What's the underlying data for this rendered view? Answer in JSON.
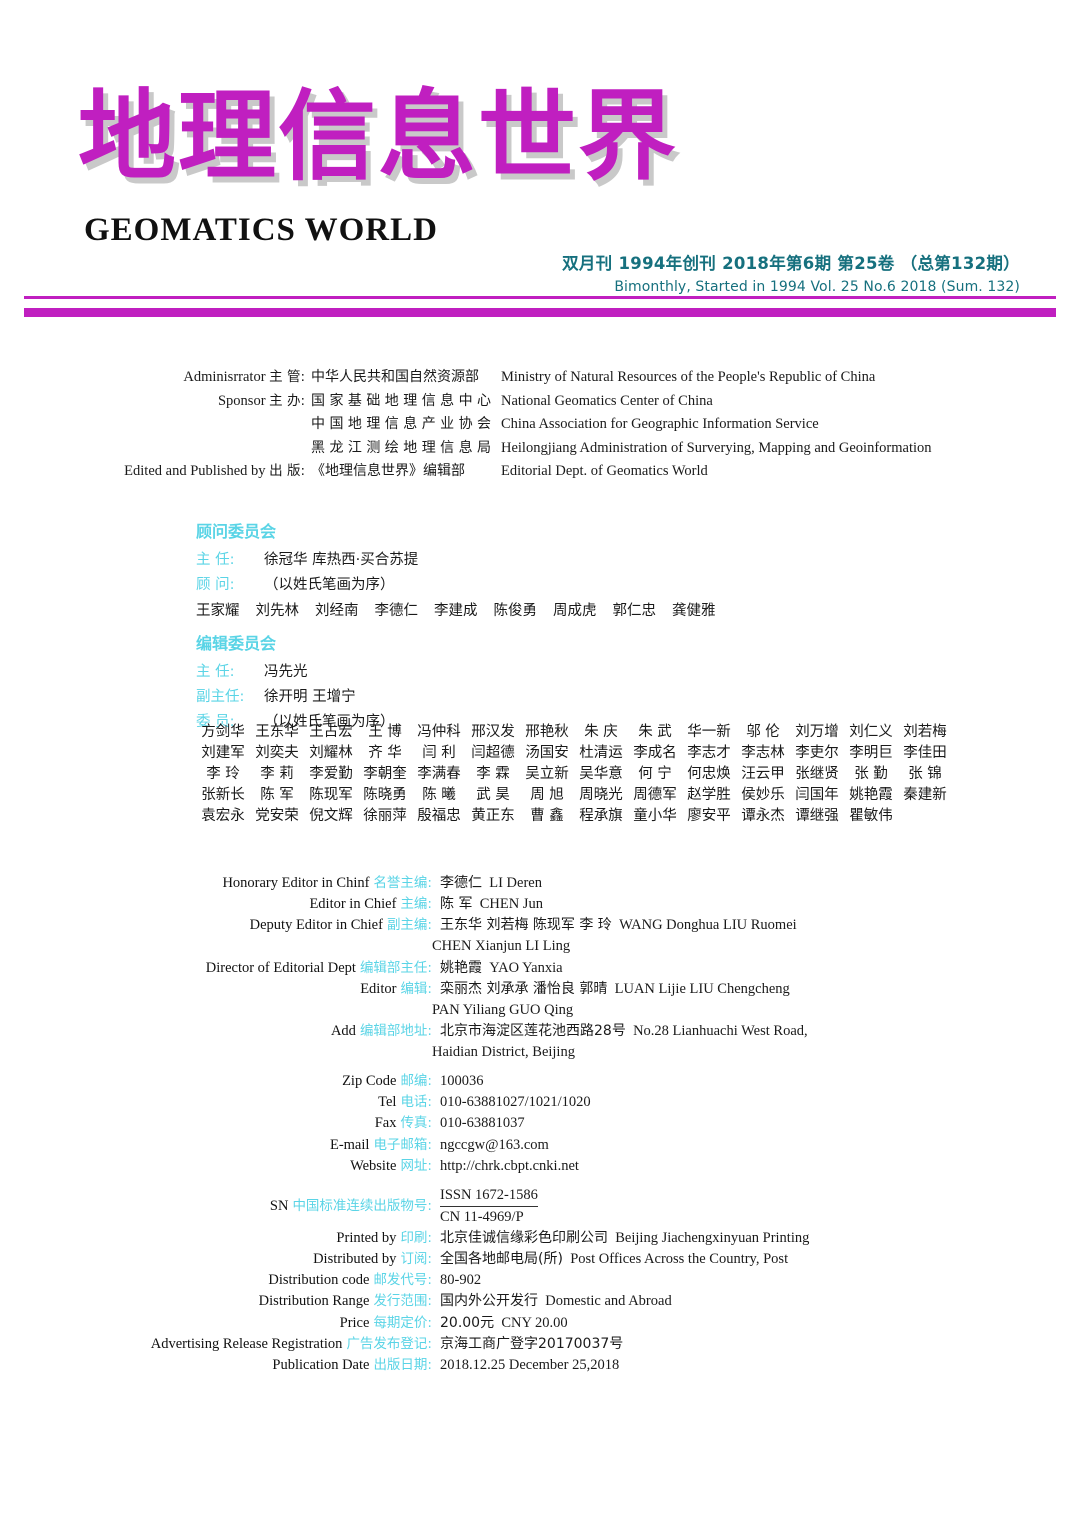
{
  "masthead": {
    "title_cn": "地理信息世界",
    "title_en": "GEOMATICS  WORLD",
    "issue_cn": "双月刊  1994年创刊  2018年第6期  第25卷 （总第132期）",
    "issue_en": "Bimonthly, Started in 1994 Vol. 25 No.6 2018 (Sum. 132)",
    "accent_color": "#c01fc0",
    "issue_color": "#16707e",
    "label_color": "#5ad4e6"
  },
  "publisher": [
    {
      "label_en": "Adminisrrator",
      "label_cn": "主  管:",
      "value_cn": "中华人民共和国自然资源部",
      "value_en": "Ministry of Natural Resources of the People's Republic of China"
    },
    {
      "label_en": "Sponsor",
      "label_cn": "主  办:",
      "value_cn": "国 家 基 础 地 理 信 息 中 心",
      "value_en": "National Geomatics Center of China"
    },
    {
      "label_en": "",
      "label_cn": "",
      "value_cn": "中 国 地 理 信 息 产 业 协 会",
      "value_en": "China Association for Geographic Information Service"
    },
    {
      "label_en": "",
      "label_cn": "",
      "value_cn": "黑 龙 江 测 绘 地 理 信 息 局",
      "value_en": "Heilongjiang Administration of Surverying, Mapping and Geoinformation"
    },
    {
      "label_en": "Edited and Published by",
      "label_cn": "出  版:",
      "value_cn": "《地理信息世界》编辑部",
      "value_en": "Editorial Dept. of Geomatics World"
    }
  ],
  "advisory": {
    "heading": "顾问委员会",
    "chair_label": "主  任:",
    "chair_value": "徐冠华    库热西·买合苏提",
    "advisor_label": "顾  问:",
    "advisor_note": "（以姓氏笔画为序）",
    "advisors": [
      "王家耀",
      "刘先林",
      "刘经南",
      "李德仁",
      "李建成",
      "陈俊勇",
      "周成虎",
      "郭仁忠",
      "龚健雅"
    ]
  },
  "editorial": {
    "heading": "编辑委员会",
    "chair_label": "主  任:",
    "chair_value": "冯先光",
    "vicechair_label": "副主任:",
    "vicechair_value": "徐开明    王增宁",
    "member_label": "委  员:",
    "member_note": "（以姓氏笔画为序）",
    "members": [
      [
        "方剑华",
        "王东华",
        "王占宏",
        "王 博",
        "冯仲科",
        "邢汉发",
        "邢艳秋",
        "朱 庆",
        "朱 武",
        "华一新",
        "邬 伦",
        "刘万增",
        "刘仁义",
        "刘若梅"
      ],
      [
        "刘建军",
        "刘奕夫",
        "刘耀林",
        "齐 华",
        "闫 利",
        "闫超德",
        "汤国安",
        "杜清运",
        "李成名",
        "李志才",
        "李志林",
        "李吏尔",
        "李明巨",
        "李佳田"
      ],
      [
        "李 玲",
        "李 莉",
        "李爱勤",
        "李朝奎",
        "李满春",
        "李 霖",
        "吴立新",
        "吴华意",
        "何 宁",
        "何忠焕",
        "汪云甲",
        "张继贤",
        "张 勤",
        "张 锦"
      ],
      [
        "张新长",
        "陈 军",
        "陈现军",
        "陈晓勇",
        "陈 曦",
        "武 昊",
        "周 旭",
        "周晓光",
        "周德军",
        "赵学胜",
        "侯妙乐",
        "闫国年",
        "姚艳霞",
        "秦建新"
      ],
      [
        "袁宏永",
        "党安荣",
        "倪文辉",
        "徐丽萍",
        "殷福忠",
        "黄正东",
        "曹 鑫",
        "程承旗",
        "童小华",
        "廖安平",
        "谭永杰",
        "谭继强",
        "瞿敏伟"
      ]
    ]
  },
  "details": [
    {
      "label_en": "Honorary Editor in Chinf",
      "label_cn": "名誉主编:",
      "value_cn": "李德仁",
      "value_en": "LI Deren",
      "cont": ""
    },
    {
      "label_en": "Editor in Chief",
      "label_cn": "主编:",
      "value_cn": "陈  军",
      "value_en": "CHEN Jun",
      "cont": ""
    },
    {
      "label_en": "Deputy Editor in Chief",
      "label_cn": "副主编:",
      "value_cn": "王东华  刘若梅  陈现军  李  玲",
      "value_en": "WANG Donghua  LIU Ruomei",
      "cont": "CHEN Xianjun  LI Ling"
    },
    {
      "label_en": "Director of Editorial Dept",
      "label_cn": "编辑部主任:",
      "value_cn": "姚艳霞",
      "value_en": "YAO Yanxia",
      "cont": ""
    },
    {
      "label_en": "Editor",
      "label_cn": "编辑:",
      "value_cn": "栾丽杰  刘承承  潘怡良  郭晴",
      "value_en": "LUAN Lijie  LIU Chengcheng",
      "cont": "PAN Yiliang  GUO Qing"
    },
    {
      "label_en": "Add",
      "label_cn": "编辑部地址:",
      "value_cn": "北京市海淀区莲花池西路28号",
      "value_en": "No.28 Lianhuachi West Road,",
      "cont": "Haidian District, Beijing"
    },
    {
      "label_en": "Zip Code",
      "label_cn": "邮编:",
      "value_cn": "",
      "value_en": "100036",
      "cont": ""
    },
    {
      "label_en": "Tel",
      "label_cn": "电话:",
      "value_cn": "",
      "value_en": "010-63881027/1021/1020",
      "cont": ""
    },
    {
      "label_en": "Fax",
      "label_cn": "传真:",
      "value_cn": "",
      "value_en": "010-63881037",
      "cont": ""
    },
    {
      "label_en": "E-mail",
      "label_cn": "电子邮箱:",
      "value_cn": "",
      "value_en": "ngccgw@163.com",
      "cont": ""
    },
    {
      "label_en": "Website",
      "label_cn": "网址:",
      "value_cn": "",
      "value_en": "http://chrk.cbpt.cnki.net",
      "cont": ""
    },
    {
      "label_en": "Printed by",
      "label_cn": "印刷:",
      "value_cn": "北京佳诚信缘彩色印刷公司",
      "value_en": "Beijing Jiachengxinyuan Printing",
      "cont": ""
    },
    {
      "label_en": "Distributed by",
      "label_cn": "订阅:",
      "value_cn": "全国各地邮电局(所)",
      "value_en": "Post Offices Across the Country, Post",
      "cont": ""
    },
    {
      "label_en": "Distribution code",
      "label_cn": "邮发代号:",
      "value_cn": "",
      "value_en": "80-902",
      "cont": ""
    },
    {
      "label_en": "Distribution Range",
      "label_cn": "发行范围:",
      "value_cn": "国内外公开发行",
      "value_en": "Domestic and Abroad",
      "cont": ""
    },
    {
      "label_en": "Price",
      "label_cn": "每期定价:",
      "value_cn": "20.00元",
      "value_en": "CNY 20.00",
      "cont": ""
    },
    {
      "label_en": "Advertising Release Registration",
      "label_cn": "广告发布登记:",
      "value_cn": "京海工商广登字20170037号",
      "value_en": "",
      "cont": ""
    },
    {
      "label_en": "Publication Date",
      "label_cn": "出版日期:",
      "value_cn": "",
      "value_en": "2018.12.25  December 25,2018",
      "cont": ""
    }
  ],
  "sn": {
    "label_en": "SN",
    "label_cn": "中国标准连续出版物号:",
    "issn": "ISSN 1672-1586",
    "cn": "CN 11-4969/P"
  }
}
